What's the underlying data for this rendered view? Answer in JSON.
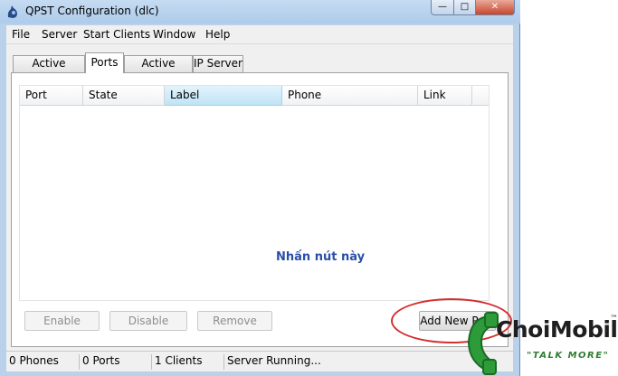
{
  "window": {
    "title": "QPST Configuration (dlc)",
    "controls": {
      "minimize": "—",
      "maximize": "□",
      "close": "✕"
    }
  },
  "menu": [
    "File",
    "Server",
    "Start Clients",
    "Window",
    "Help"
  ],
  "tabs": [
    {
      "label": "Active Phones",
      "active": false
    },
    {
      "label": "Ports",
      "active": true
    },
    {
      "label": "Active Clients",
      "active": false
    },
    {
      "label": "IP Server",
      "active": false
    }
  ],
  "table": {
    "columns": [
      "Port",
      "State",
      "Label",
      "Phone",
      "Link"
    ],
    "selected_column": "Label",
    "rows": []
  },
  "hint_text": "Nhấn nút này",
  "buttons": {
    "enable": "Enable",
    "disable": "Disable",
    "remove": "Remove",
    "add_new_port": "Add New Po..."
  },
  "statusbar": [
    "0 Phones",
    "0 Ports",
    "1 Clients",
    "Server Running..."
  ],
  "watermark": {
    "brand": "ChoiMobile",
    "tagline": "\"TALK MORE\"",
    "tm": "™"
  },
  "colors": {
    "hint": "#2b4fa8",
    "annotation": "#d32f2f",
    "brand_green": "#2e7d32"
  }
}
